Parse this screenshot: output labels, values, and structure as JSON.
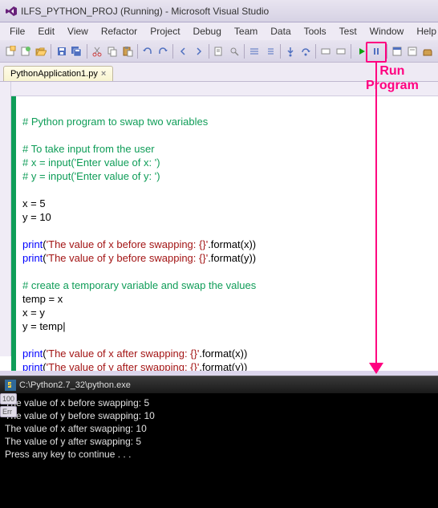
{
  "titlebar": {
    "text": "ILFS_PYTHON_PROJ (Running) - Microsoft Visual Studio"
  },
  "menu": {
    "file": "File",
    "edit": "Edit",
    "view": "View",
    "refactor": "Refactor",
    "project": "Project",
    "debug": "Debug",
    "team": "Team",
    "data": "Data",
    "tools": "Tools",
    "test": "Test",
    "window": "Window",
    "help": "Help"
  },
  "tab": {
    "name": "PythonApplication1.py"
  },
  "annotation": {
    "line1": "Run",
    "line2": "Program"
  },
  "code": {
    "l1": "# Python program to swap two variables",
    "l2": "# To take input from the user",
    "l3": "# x = input('Enter value of x: ')",
    "l4": "# y = input('Enter value of y: ')",
    "l5a": "x = ",
    "l5b": "5",
    "l6a": "y = ",
    "l6b": "10",
    "l7a": "print",
    "l7b": "(",
    "l7c": "'The value of x before swapping: {}'",
    "l7d": ".format(x))",
    "l8a": "print",
    "l8b": "(",
    "l8c": "'The value of y before swapping: {}'",
    "l8d": ".format(y))",
    "l9": "# create a temporary variable and swap the values",
    "l10": "temp = x",
    "l11": "x = y",
    "l12": "y = temp",
    "l13a": "print",
    "l13b": "(",
    "l13c": "'The value of x after swapping: {}'",
    "l13d": ".format(x))",
    "l14a": "print",
    "l14b": "(",
    "l14c": "'The value of y after swapping: {}'",
    "l14d": ".format(y))"
  },
  "console": {
    "title": "C:\\Python2.7_32\\python.exe",
    "l1": "The value of x before swapping: 5",
    "l2": "The value of y before swapping: 10",
    "l3": "The value of x after swapping: 10",
    "l4": "The value of y after swapping: 5",
    "l5": "Press any key to continue . . ."
  },
  "sidebar": {
    "row": "100",
    "err": "Err"
  }
}
